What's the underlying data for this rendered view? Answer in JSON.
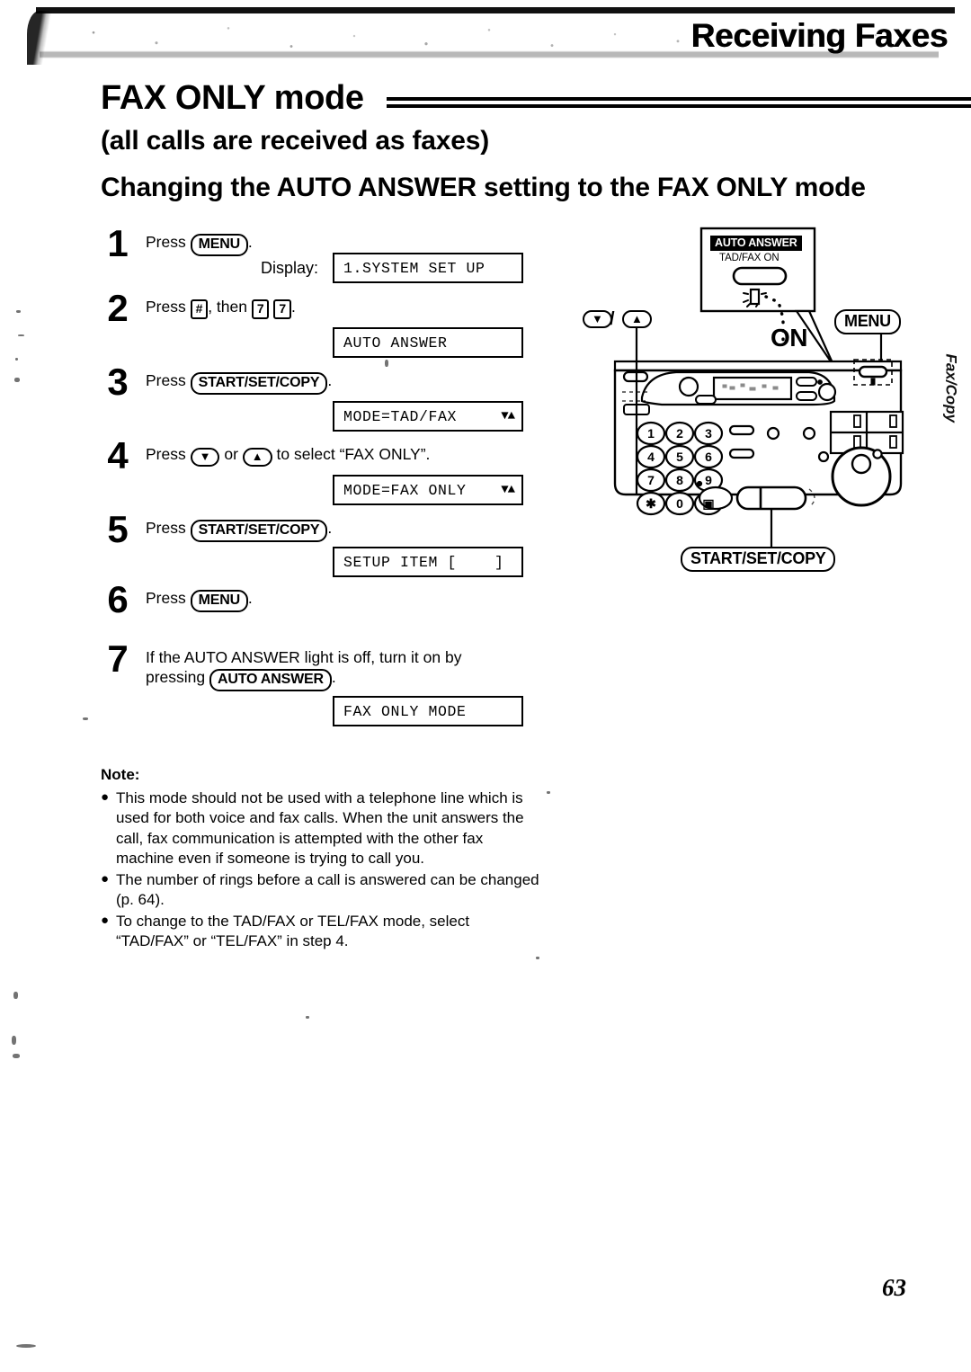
{
  "header": {
    "title": "Receiving Faxes"
  },
  "titles": {
    "main": "FAX ONLY mode",
    "subtitle": "(all calls are received as faxes)",
    "section": "Changing the AUTO ANSWER setting to the FAX ONLY mode"
  },
  "display_label": "Display:",
  "steps": [
    {
      "num": "1",
      "text_before": "Press",
      "key": "MENU",
      "text_after": ".",
      "lcd": "1.SYSTEM SET UP",
      "lcd_arrows": ""
    },
    {
      "num": "2",
      "text_before": "Press",
      "key": "#",
      "text_mid": ", then",
      "key2": "7",
      "key3": "7",
      "text_after": ".",
      "lcd": "AUTO ANSWER",
      "lcd_arrows": ""
    },
    {
      "num": "3",
      "text_before": "Press",
      "key": "START/SET/COPY",
      "text_after": ".",
      "lcd": "MODE=TAD/FAX",
      "lcd_arrows": "▼▲"
    },
    {
      "num": "4",
      "text_before": "Press",
      "key": "▼",
      "text_mid": "or",
      "key2": "▲",
      "text_after": "to select “FAX ONLY”.",
      "lcd": "MODE=FAX ONLY",
      "lcd_arrows": "▼▲"
    },
    {
      "num": "5",
      "text_before": "Press",
      "key": "START/SET/COPY",
      "text_after": ".",
      "lcd": "SETUP ITEM [    ]",
      "lcd_arrows": ""
    },
    {
      "num": "6",
      "text_before": "Press",
      "key": "MENU",
      "text_after": ".",
      "lcd": "",
      "lcd_arrows": ""
    },
    {
      "num": "7",
      "text_before": "If the AUTO ANSWER light is off, turn it on by pressing",
      "key": "AUTO ANSWER",
      "text_after": ".",
      "lcd": "FAX ONLY MODE",
      "lcd_arrows": ""
    }
  ],
  "note": {
    "heading": "Note:",
    "bullet": "●",
    "items": [
      "This mode should not be used with a telephone line which is used for both voice and fax calls. When the unit answers the call, fax communication is attempted with the other fax machine even if someone is trying to call you.",
      "The number of rings before a call is answered can be changed (p. 64).",
      "To change to the TAD/FAX or TEL/FAX mode, select “TAD/FAX” or “TEL/FAX” in step 4."
    ]
  },
  "illustration": {
    "callout_badge": "AUTO ANSWER",
    "callout_sub": "TAD/FAX ON",
    "on_label": "ON",
    "key_updown": "▼",
    "key_updown_sep": "/",
    "key_updown2": "▲",
    "key_menu": "MENU",
    "key_startsetcopy": "START/SET/COPY",
    "keypad": [
      "1",
      "2",
      "3",
      "4",
      "5",
      "6",
      "7",
      "8",
      "9",
      "✱",
      "0",
      "▣"
    ]
  },
  "side_tab": "Fax/Copy",
  "page_number": "63"
}
